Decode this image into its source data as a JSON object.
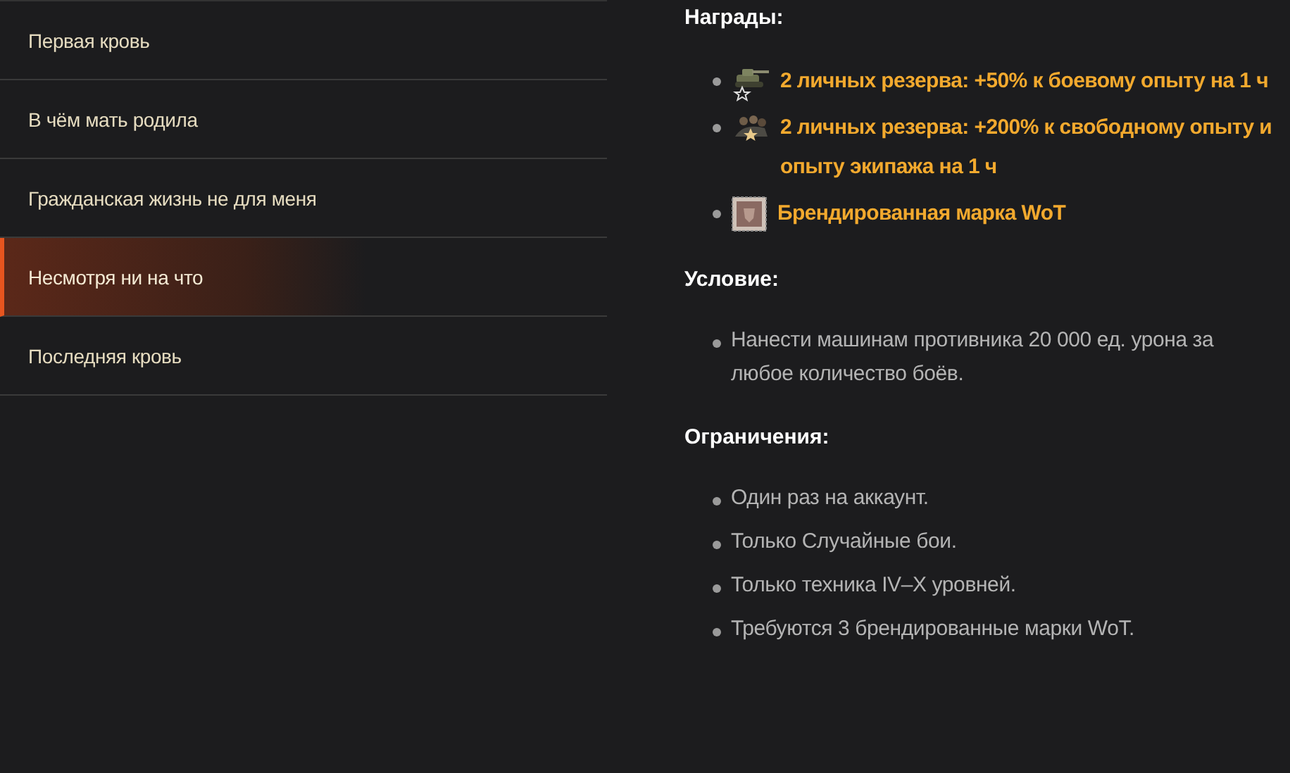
{
  "missions": [
    {
      "label": "Первая кровь",
      "selected": false
    },
    {
      "label": "В чём мать родила",
      "selected": false
    },
    {
      "label": "Гражданская жизнь не для меня",
      "selected": false
    },
    {
      "label": "Несмотря ни на что",
      "selected": true
    },
    {
      "label": "Последняя кровь",
      "selected": false
    }
  ],
  "rewards": {
    "heading": "Награды:",
    "items": [
      {
        "kind": "reserve-tank",
        "text": "2 личных резерва: +50% к боевому опыту на 1 ч"
      },
      {
        "kind": "reserve-crew",
        "text": "2 личных резерва: +200% к свободному опыту и опыту экипажа на 1 ч"
      },
      {
        "kind": "stamp",
        "text": "Брендированная марка WoT"
      }
    ]
  },
  "condition": {
    "heading": "Условие:",
    "items": [
      "Нанести машинам противника 20 000 ед. урона за любое количество боёв."
    ]
  },
  "restrictions": {
    "heading": "Ограничения:",
    "items": [
      "Один раз на аккаунт.",
      "Только Случайные бои.",
      "Только техника IV–X уровней.",
      "Требуются 3 брендированные марки WoT."
    ]
  }
}
